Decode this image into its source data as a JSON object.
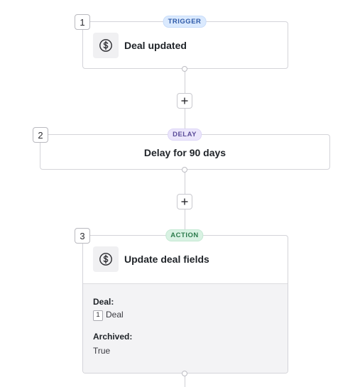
{
  "steps": [
    {
      "number": "1",
      "badge": "TRIGGER",
      "title": "Deal updated",
      "icon": "dollar-circle-icon"
    },
    {
      "number": "2",
      "badge": "DELAY",
      "title": "Delay for 90 days"
    },
    {
      "number": "3",
      "badge": "ACTION",
      "title": "Update deal fields",
      "icon": "dollar-circle-icon",
      "fields": [
        {
          "label": "Deal:",
          "ref_number": "1",
          "value": "Deal"
        },
        {
          "label": "Archived:",
          "value": "True"
        }
      ]
    }
  ],
  "add_buttons": [
    {
      "label": "+"
    },
    {
      "label": "+"
    }
  ],
  "colors": {
    "trigger_badge": "#dbeafe",
    "delay_badge": "#ebe6fb",
    "action_badge": "#d9f2e3",
    "connector": "#cfcfd4"
  }
}
